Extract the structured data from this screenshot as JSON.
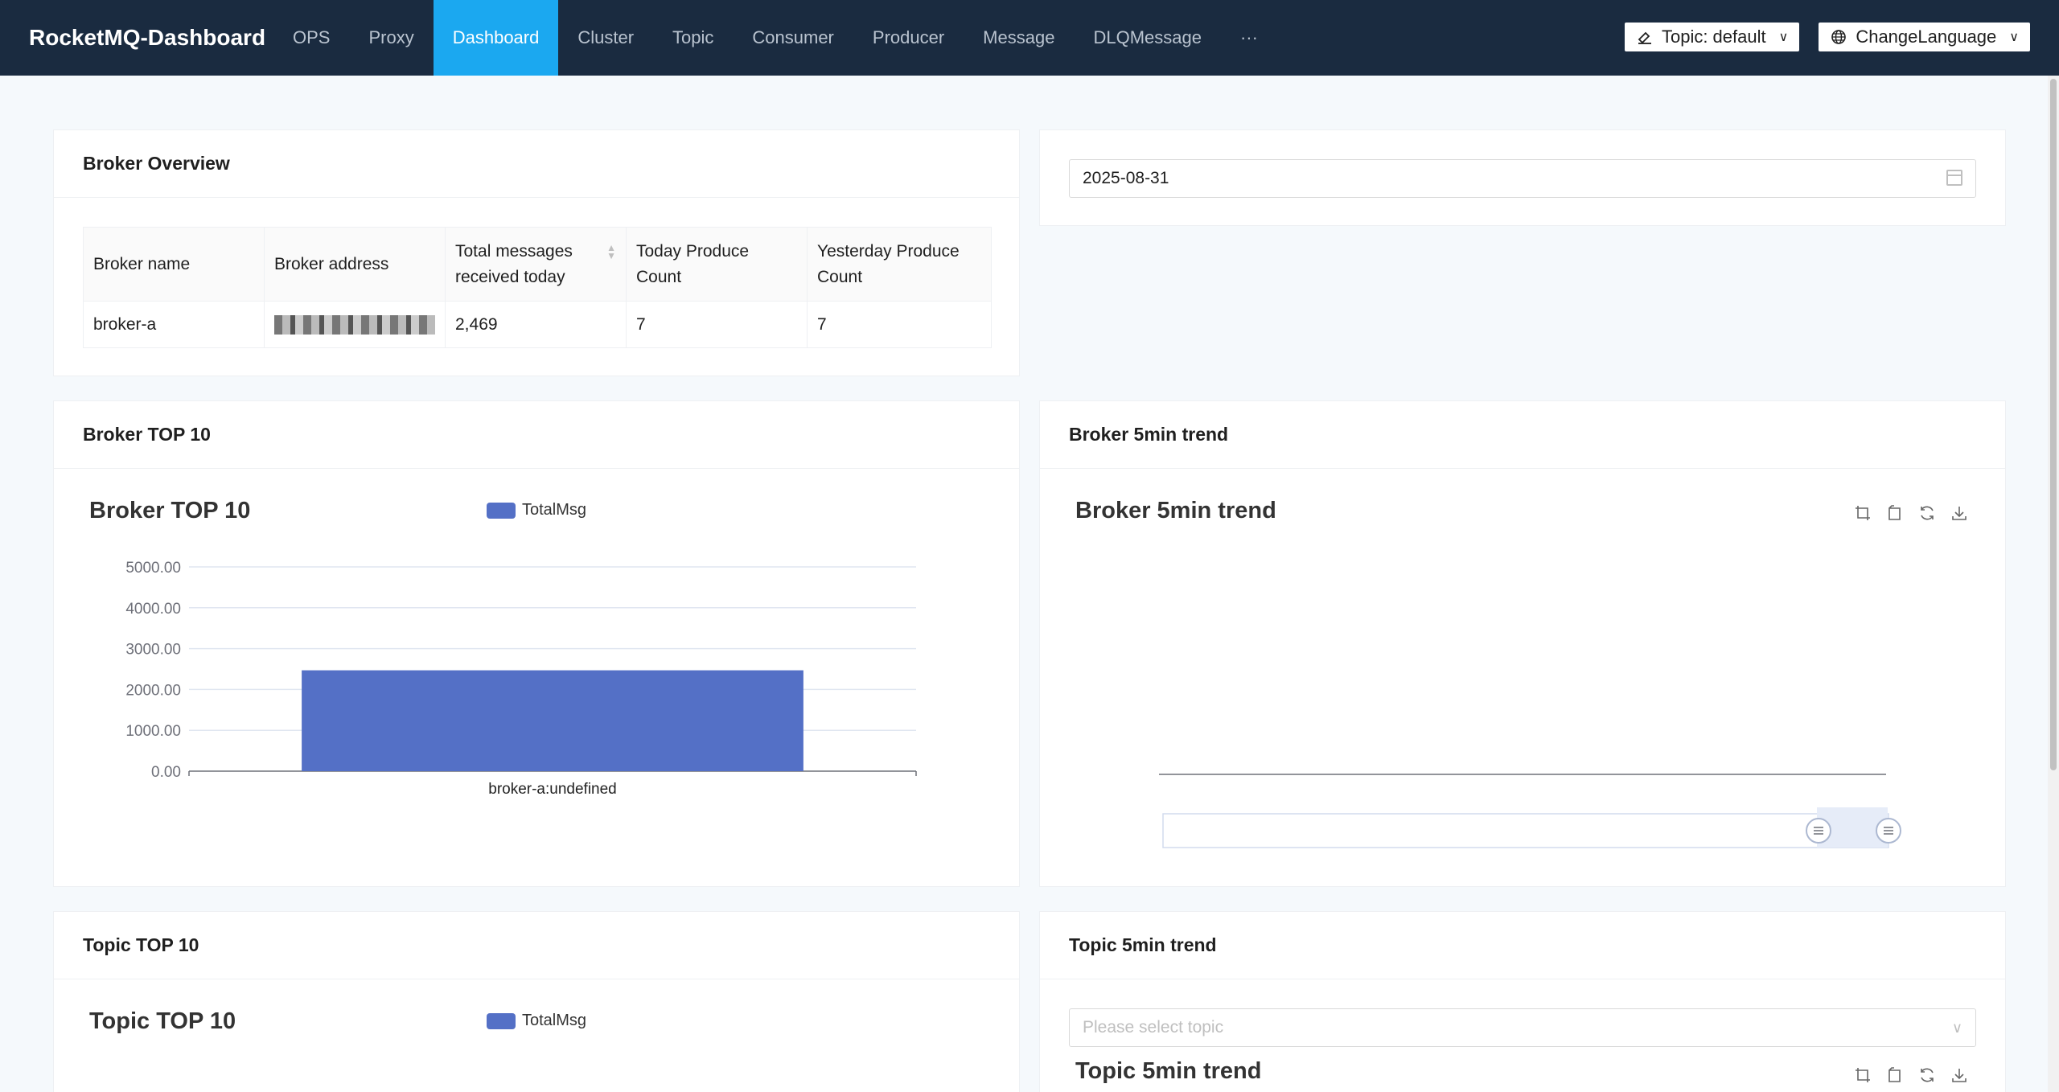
{
  "nav": {
    "brand": "RocketMQ-Dashboard",
    "items": [
      "OPS",
      "Proxy",
      "Dashboard",
      "Cluster",
      "Topic",
      "Consumer",
      "Producer",
      "Message",
      "DLQMessage",
      "···"
    ],
    "active_index": 2,
    "topic_button": "Topic: default",
    "language_button": "ChangeLanguage"
  },
  "broker_overview": {
    "title": "Broker Overview",
    "columns": [
      "Broker name",
      "Broker address",
      "Total messages received today",
      "Today Produce Count",
      "Yesterday Produce Count"
    ],
    "rows": [
      {
        "name": "broker-a",
        "address": "",
        "total": "2,469",
        "today": "7",
        "yesterday": "7"
      }
    ]
  },
  "date_picker": {
    "value": "2025-08-31"
  },
  "broker_top10": {
    "card_title": "Broker TOP 10",
    "chart_title": "Broker TOP 10",
    "legend": "TotalMsg"
  },
  "broker_trend": {
    "card_title": "Broker 5min trend",
    "chart_title": "Broker 5min trend"
  },
  "topic_top10": {
    "card_title": "Topic TOP 10",
    "chart_title": "Topic TOP 10",
    "legend": "TotalMsg"
  },
  "topic_trend": {
    "card_title": "Topic 5min trend",
    "chart_title": "Topic 5min trend",
    "select_placeholder": "Please select topic"
  },
  "colors": {
    "nav_bg": "#1a2b40",
    "nav_active": "#1ba8f0",
    "bar": "#5470c6"
  },
  "chart_data": [
    {
      "type": "bar",
      "title": "Broker TOP 10",
      "categories": [
        "broker-a:undefined"
      ],
      "series": [
        {
          "name": "TotalMsg",
          "values": [
            2469
          ]
        }
      ],
      "ylim": [
        0,
        5000
      ],
      "yticks": [
        "0.00",
        "1000.00",
        "2000.00",
        "3000.00",
        "4000.00",
        "5000.00"
      ],
      "grid": true,
      "legend": "top"
    },
    {
      "type": "line",
      "title": "Broker 5min trend",
      "series": [],
      "grid": false
    }
  ]
}
